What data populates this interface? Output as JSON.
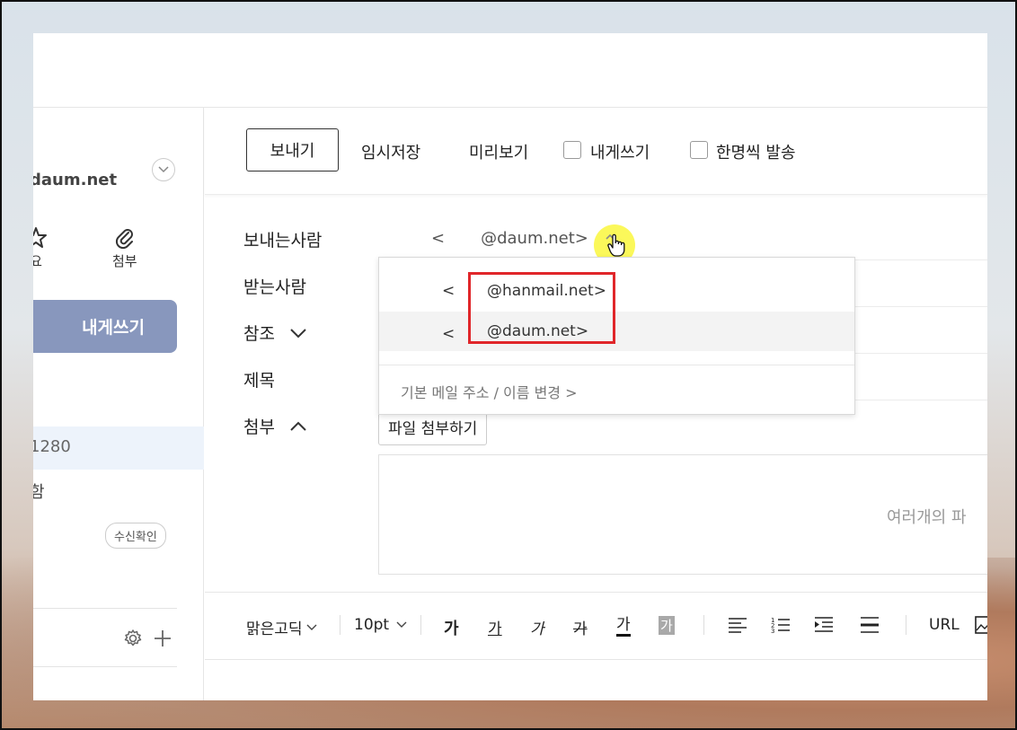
{
  "sidebar": {
    "account": "daum.net",
    "quick_important": "요",
    "quick_attach": "첨부",
    "write_button": "내게쓰기",
    "inbox_count": "1280",
    "mail_item": "함",
    "receipt_badge": "수신확인"
  },
  "toolbar": {
    "send": "보내기",
    "save_draft": "임시저장",
    "preview": "미리보기",
    "to_self": "내게쓰기",
    "send_individually": "한명씩 발송"
  },
  "form": {
    "from_label": "보내는사람",
    "sender_left": "<",
    "sender_address": "@daum.net>",
    "to_label": "받는사람",
    "cc_label": "참조",
    "subject_label": "제목",
    "attach_label": "첨부",
    "attach_button": "파일 첨부하기",
    "drop_hint": "여러개의 파"
  },
  "dropdown": {
    "items": [
      {
        "prefix": "<",
        "address": "@hanmail.net>"
      },
      {
        "prefix": "<　",
        "address": "@daum.net>"
      }
    ],
    "footer": "기본 메일 주소 / 이름 변경 >"
  },
  "editor": {
    "font": "맑은고딕",
    "size": "10pt",
    "bold": "가",
    "underline": "가",
    "italic": "가",
    "strike": "가",
    "font_color": "가",
    "bg_color": "가",
    "url": "URL"
  },
  "colors": {
    "write_button_bg": "#8897bd",
    "highlight": "#fbf85a",
    "annotation": "#e0262a"
  }
}
